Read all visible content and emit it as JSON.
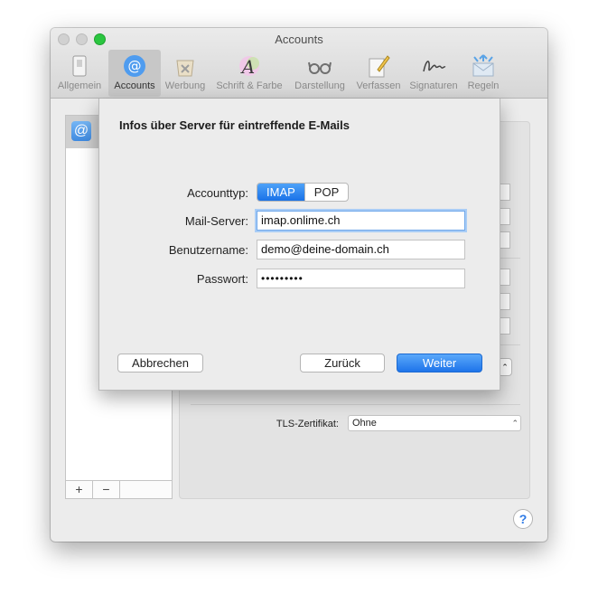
{
  "window": {
    "title": "Accounts"
  },
  "toolbar": {
    "items": [
      {
        "label": "Allgemein",
        "icon": "switch-icon"
      },
      {
        "label": "Accounts",
        "icon": "at-icon",
        "active": true
      },
      {
        "label": "Werbung",
        "icon": "junk-icon"
      },
      {
        "label": "Schrift & Farbe",
        "icon": "font-icon"
      },
      {
        "label": "Darstellung",
        "icon": "glasses-icon"
      },
      {
        "label": "Verfassen",
        "icon": "pencil-icon"
      },
      {
        "label": "Signaturen",
        "icon": "signature-icon"
      },
      {
        "label": "Regeln",
        "icon": "rules-icon"
      }
    ]
  },
  "sidebar": {
    "add_label": "+",
    "remove_label": "−",
    "account_icon": "@"
  },
  "main": {
    "tls_label": "TLS-Zertifikat:",
    "tls_value": "Ohne",
    "help_label": "?"
  },
  "sheet": {
    "title": "Infos über Server für eintreffende E-Mails",
    "account_type_label": "Accounttyp:",
    "account_types": [
      "IMAP",
      "POP"
    ],
    "selected_type": "IMAP",
    "mail_server_label": "Mail-Server:",
    "mail_server_value": "imap.onlime.ch",
    "username_label": "Benutzername:",
    "username_value": "demo@deine-domain.ch",
    "password_label": "Passwort:",
    "password_value": "•••••••••",
    "cancel_label": "Abbrechen",
    "back_label": "Zurück",
    "next_label": "Weiter"
  },
  "colors": {
    "accent": "#1a72e8",
    "focus_ring": "#a9cdf6"
  }
}
